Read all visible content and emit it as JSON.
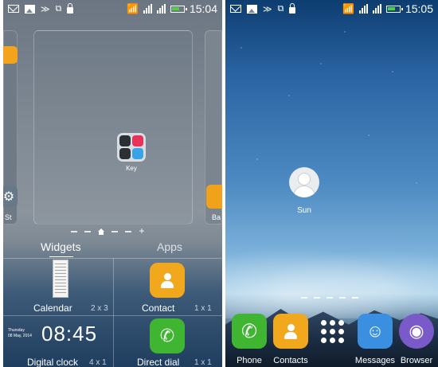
{
  "left": {
    "status_bar": {
      "time": "15:04"
    },
    "folder": {
      "label": "Key"
    },
    "peek": {
      "left_label": "St",
      "right_label": "Ba"
    },
    "tabs": {
      "widgets": "Widgets",
      "apps": "Apps"
    },
    "widgets": [
      {
        "name": "Calendar",
        "size": "2 x 3"
      },
      {
        "name": "Contact",
        "size": "1 x 1"
      },
      {
        "name": "Digital clock",
        "size": "4 x 1",
        "time": "08:45",
        "day": "Thursday",
        "date": "08 May, 2014"
      },
      {
        "name": "Direct dial",
        "size": "1 x 1"
      }
    ]
  },
  "right": {
    "status_bar": {
      "time": "15:05"
    },
    "contact": {
      "name": "Sun"
    },
    "dock": [
      {
        "label": "Phone",
        "icon": "phone-icon"
      },
      {
        "label": "Contacts",
        "icon": "contact-icon"
      },
      {
        "label": "",
        "icon": "app-drawer-icon"
      },
      {
        "label": "Messages",
        "icon": "messages-icon"
      },
      {
        "label": "Browser",
        "icon": "browser-icon"
      }
    ]
  },
  "colors": {
    "phone_green": "#3fb531",
    "contact_orange": "#f2a81c",
    "messages_blue": "#3a8fe0",
    "browser_purple": "#7a59c9"
  }
}
